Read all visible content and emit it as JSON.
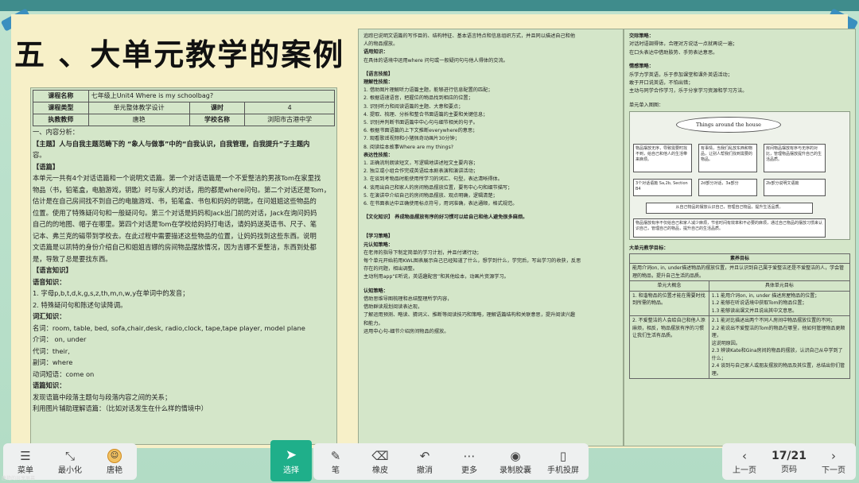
{
  "slide": {
    "title": "五 、大单元教学的案例"
  },
  "doc_a": {
    "table": [
      {
        "k1": "课程名称",
        "v1": "七年级上Unit4 Where is my schoolbag?"
      },
      {
        "k1": "课程类型",
        "v1": "单元整体教学设计",
        "k2": "课时",
        "v2": "4"
      },
      {
        "k1": "执教教师",
        "v1": "唐艳",
        "k2": "学校名称",
        "v2": "浏阳市古港中学"
      }
    ],
    "lines": [
      "一、内容分析：",
      "【主题】人与自我主题范畴下的 “象人与做事”中的“自我认识，自我管理，自我提升”子主题内",
      "容。",
      "【语篇】",
      " 本单元一共有4个对话语篇和一个说明文语篇。第一个对话语篇是一个不爱整洁的男孩Tom在家里找",
      "物品（书，铅笔盒，电脑游戏，钥匙）时与家人的对话，用的都是where问句。第二个对话还是Tom，",
      "估计是在自己房间找不到自己的电脑游戏、书，铅笔盒、书包和妈妈的钥匙，在问姐姐这些物品的",
      "位置。使用了特殊疑问句和一般疑问句。第三个对话是妈妈和Jack出门前的对话，Jack在询问妈妈",
      "自己的的地图、帽子在哪里。第四个对话是Tom在学校给妈妈打电话，请妈妈送英语书、尺子、笔",
      "记本、弗兰克的磁带到学校去。在此过程中需要描述这些物品的位置，让妈妈找到这些东西。说明",
      "文语篇是以凯特的身份介绍自己和姐姐吉娜的房间物品摆放情况，因为吉娜不爱整洁，东西到处都",
      "是，导致了总是要找东西。",
      "【语言知识】",
      "语音知识：",
      "1. 字母p,b,t,d,k,g,s,z,th,m,n,w,y在单词中的发音；",
      "2. 特殊疑问句和陈述句读降调。",
      "词汇知识：",
      "名词：room, table, bed, sofa,chair,desk, radio,clock, tape,tape player, model plane",
      "介词： on, under",
      "代词：their,",
      "副词：where",
      "动词短语：come on",
      "语篇知识：",
      "发现语篇中段落主题句与段落内容之间的关系；",
      "利用图片辅助理解语篇：（比如对话发生在什么样的情境中）"
    ]
  },
  "doc_b": {
    "lines": [
      "追踪已说明文语篇的写作目的、结构特征、基本语言特点和信息组织方式，并且同以描述自己和他",
      "人的物品摆放。",
      "语用知识：",
      "在具体的语境中运用where 问句或一般疑问句与他人得体的交流。",
      "",
      "【语言技能】",
      "理解性技能：",
      "1. 借助图片理解听力语篇主题，能够进行信息配置的匹配；",
      "2. 根据语速语音，把握位的物品找到相应的位置；",
      "3. 识别听力和阅读语篇的主题、大意和要点；",
      "4. 提取、梳理、分析和整合书面语篇的主要和关键信息；",
      "5. 识别并判断书面语篇中中心句与细节相关的句子。",
      "6. 根据书面语篇的上下文推断everywhere的意思；",
      "7. 观看歌谣视频和小猪佩奇动画片30分钟；",
      "8. 阅读绘本故事Where are my things?",
      "表达性技能：",
      "1. 正确流利朗读短文，写逻辑地讲述短文主要内容；",
      "2. 独立或小组合作完成英语绘本剧表演和演讲活动；",
      "3. 在谈到考物品时能使用所学习的词汇、句型，表达清晰得体。",
      "4. 谈用出自己和家人的房间物品摆放位置，要有中心句和细节描写；",
      "5. 在演讲中介绍自己的房间物品摆放、观点明确，逻辑清楚；",
      "6. 在书面表达中正确使用标点符号，用词准确，表达通顺，格式规范。",
      "",
      "【文化知识】 养成物品摆放有序的好习惯可以给自己和他人避免很多麻烦。",
      "",
      "",
      "【学习策略】",
      "元认知策略：",
      "在老师的指导下制定简单的学习计划，并且付诸行动；",
      "每个单元开始前用KWL图表展示自己已经知道了什么，想学到什么，学完后，写出学习的收获，反思",
      "存在的问题，相出调整。",
      "主动利用app“E听说，英语趣配音”和其他绘本，动画片资源学习。",
      "",
      "认知策略：",
      "借助思维导图梳理和总结整理所学内容，",
      "借助群读规划阅读表达现，",
      "了解运用预测、略读、猜词义、推断等阅读技巧和策略，理解语篇结构和关联意思，提升阅读兴趣",
      "和能力。",
      "运用中心句-细节介绍房间物品的摆放。"
    ]
  },
  "doc_c": {
    "lines_top": [
      "交际策略：",
      "对话时语調得体，合理对方说话一点就再说一遍；",
      "在口头表达中借助肢势、手势表达意思。",
      "",
      "情感策略：",
      "乐学力学英语，乐于参加课堂和课外英语活动；",
      "敢于开口说英语，不怕出错；",
      "主动与同学合作学习，乐于分享学习资源和学习方法。",
      "",
      "单元单入图图："
    ],
    "diagram": {
      "center": "Things around the house",
      "boxes": [
        "物品摆放无序，导致需要时找不到，给自己和他人的生活带来麻烦。",
        "有事情，当我们乱放东西和物品，让别人帮我们找到需要的物品。",
        "房间物品摆放有序与无序的对比，管理物品摆放提升自己的生活品质。",
        "3个对话语篇 Sa,2b, Section B4",
        "2d部分对话，3a部分",
        "2b部分说明文语篇"
      ],
      "bottom1": "从自己物品的摆放认识自己，管理自己物品，提升生活品质。",
      "bottom2": "物品摆放有序不仅给自己和家人减少麻烦，节省时间有效率和不必要的麻烦，通过自己物品的摆放习惯来认识自己，管理自己的物品，提升自己的生活品质。"
    },
    "goal_title": "大单元教学目标：",
    "goal_header": "素养目标",
    "goal_intro": "能用介词on, in, under描述物品的摆放位置，并且认识到自己属于爱整洁还是不爱整洁的人，学会管理的物品，提升自己生活的品质。",
    "goal_cols": [
      "单元大概念",
      "具体单元目标"
    ],
    "goal_rows": [
      {
        "left": "1. 和谐物品的位置才能在需要时找到所需的物品。",
        "right": [
          "1.1 能用介词on, in, under 描述房屋物品的位置；",
          "1.2 能够在听说语境中获取Tom的物品位置；",
          "1.3 能够读出课文并且说出其中文意思。"
        ]
      },
      {
        "left": "2. 不爱整洁的人会给自己和他人添麻烦，相反，物品摆放有序的习惯让我们生活有品质。",
        "right": [
          "2.1 能对比描述出两个不同人房间中物品摆放位置的不同；",
          "2.2 能说出不爱整洁的Tom的物品在哪里，他如何管理物品更顺理，",
          "这说明原因。",
          "2.3 辨读Kate和Gina房间的物品的摆放，认识自己从中学到了什么；",
          "2.4 谈到与自己家人或朋友摆放的物品及其位置，总结出你们管理。"
        ]
      }
    ]
  },
  "toolbar": {
    "menu": "菜单",
    "minimize": "最小化",
    "user": "唐艳",
    "select": "选择",
    "pen": "笔",
    "eraser": "橡皮",
    "undo": "撤消",
    "more": "更多",
    "record": "录制胶囊",
    "phone": "手机投屏",
    "prev": "上一页",
    "page_label": "页码",
    "page": "17/21",
    "next": "下一页"
  },
  "caption": "唐艳的共享屏幕"
}
